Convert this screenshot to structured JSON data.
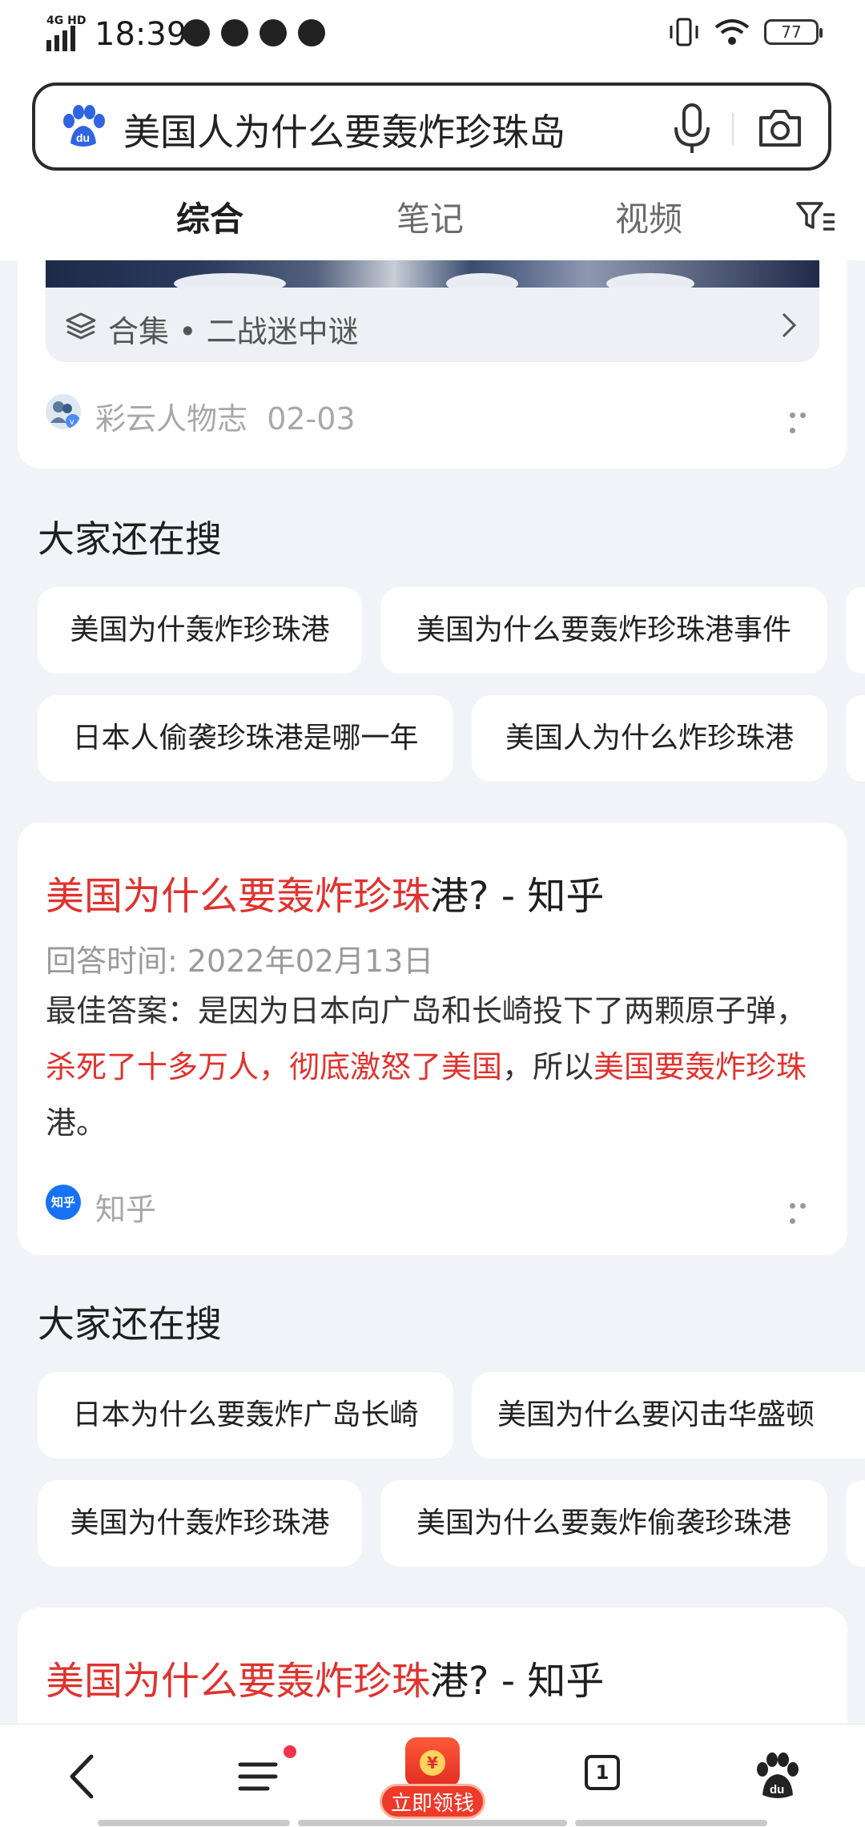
{
  "status_bar": {
    "network": "4G HD",
    "time": "18:39",
    "battery": "77"
  },
  "search": {
    "query": "美国人为什么要轰炸珍珠岛"
  },
  "tabs": [
    {
      "label": "综合",
      "active": true
    },
    {
      "label": "笔记",
      "active": false
    },
    {
      "label": "视频",
      "active": false
    }
  ],
  "top_card": {
    "collection_label": "合集 • 二战迷中谜",
    "author": "彩云人物志",
    "date": "02-03"
  },
  "related_1": {
    "title": "大家还在搜",
    "chips": [
      "美国为什轰炸珍珠港",
      "美国为什么要轰炸珍珠港事件",
      "日本人偷袭珍珠港是哪一年",
      "美国人为什么炸珍珠港"
    ]
  },
  "result_1": {
    "title_highlight": "美国为什么要轰炸珍珠",
    "title_rest": "港? - 知乎",
    "date": "回答时间: 2022年02月13日",
    "body_1": "最佳答案：是因为日本向广岛和长崎投下了两颗原子弹，",
    "body_2_red": "杀死了十多万人，彻底激怒了美国",
    "body_3": "，所以",
    "body_4_red": "美国要轰炸珍珠",
    "body_5": "港。",
    "source": "知乎",
    "source_logo_text": "知乎"
  },
  "related_2": {
    "title": "大家还在搜",
    "chips": [
      "日本为什么要轰炸广岛长崎",
      "美国为什么要闪击华盛顿",
      "美国为什轰炸珍珠港",
      "美国为什么要轰炸偷袭珍珠港"
    ]
  },
  "result_2": {
    "title_highlight": "美国为什么要轰炸珍珠",
    "title_rest": "港? - 知乎"
  },
  "bottom_bar": {
    "tab_count": "1",
    "reward_label": "立即领钱",
    "reward_coin": "¥"
  },
  "colors": {
    "accent": "#4e6ef2",
    "highlight": "#e0322e",
    "background": "#f2f3f8"
  }
}
